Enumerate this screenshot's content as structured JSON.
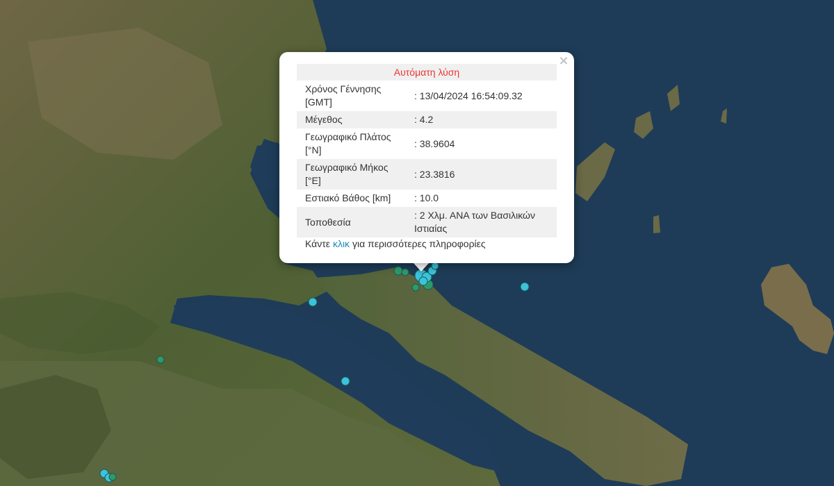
{
  "popup": {
    "title": "Αυτόματη λύση",
    "close_icon": "×",
    "rows": [
      {
        "label": "Χρόνος Γέννησης [GMT]",
        "value": ": 13/04/2024 16:54:09.32"
      },
      {
        "label": "Μέγεθος",
        "value": ": 4.2"
      },
      {
        "label": "Γεωγραφικό Πλάτος [°N]",
        "value": ": 38.9604"
      },
      {
        "label": "Γεωγραφικό Μήκος [°E]",
        "value": ": 23.3816"
      },
      {
        "label": "Εστιακό Βάθος [km]",
        "value": ": 10.0"
      },
      {
        "label": "Τοποθεσία",
        "value": ": 2 Χλμ. ΑΝΑ των Βασιλικών Ιστιαίας"
      }
    ],
    "footer_prefix": "Κάντε",
    "footer_link": "κλικ",
    "footer_suffix": "για περισσότερες πληροφορίες"
  },
  "map": {
    "basemap": "satellite-imagery",
    "colors": {
      "sea": "#1d3a55",
      "land": "#5b6a3a",
      "marker_cyan": "#3bc3da",
      "marker_green": "#2e9a6a"
    }
  }
}
